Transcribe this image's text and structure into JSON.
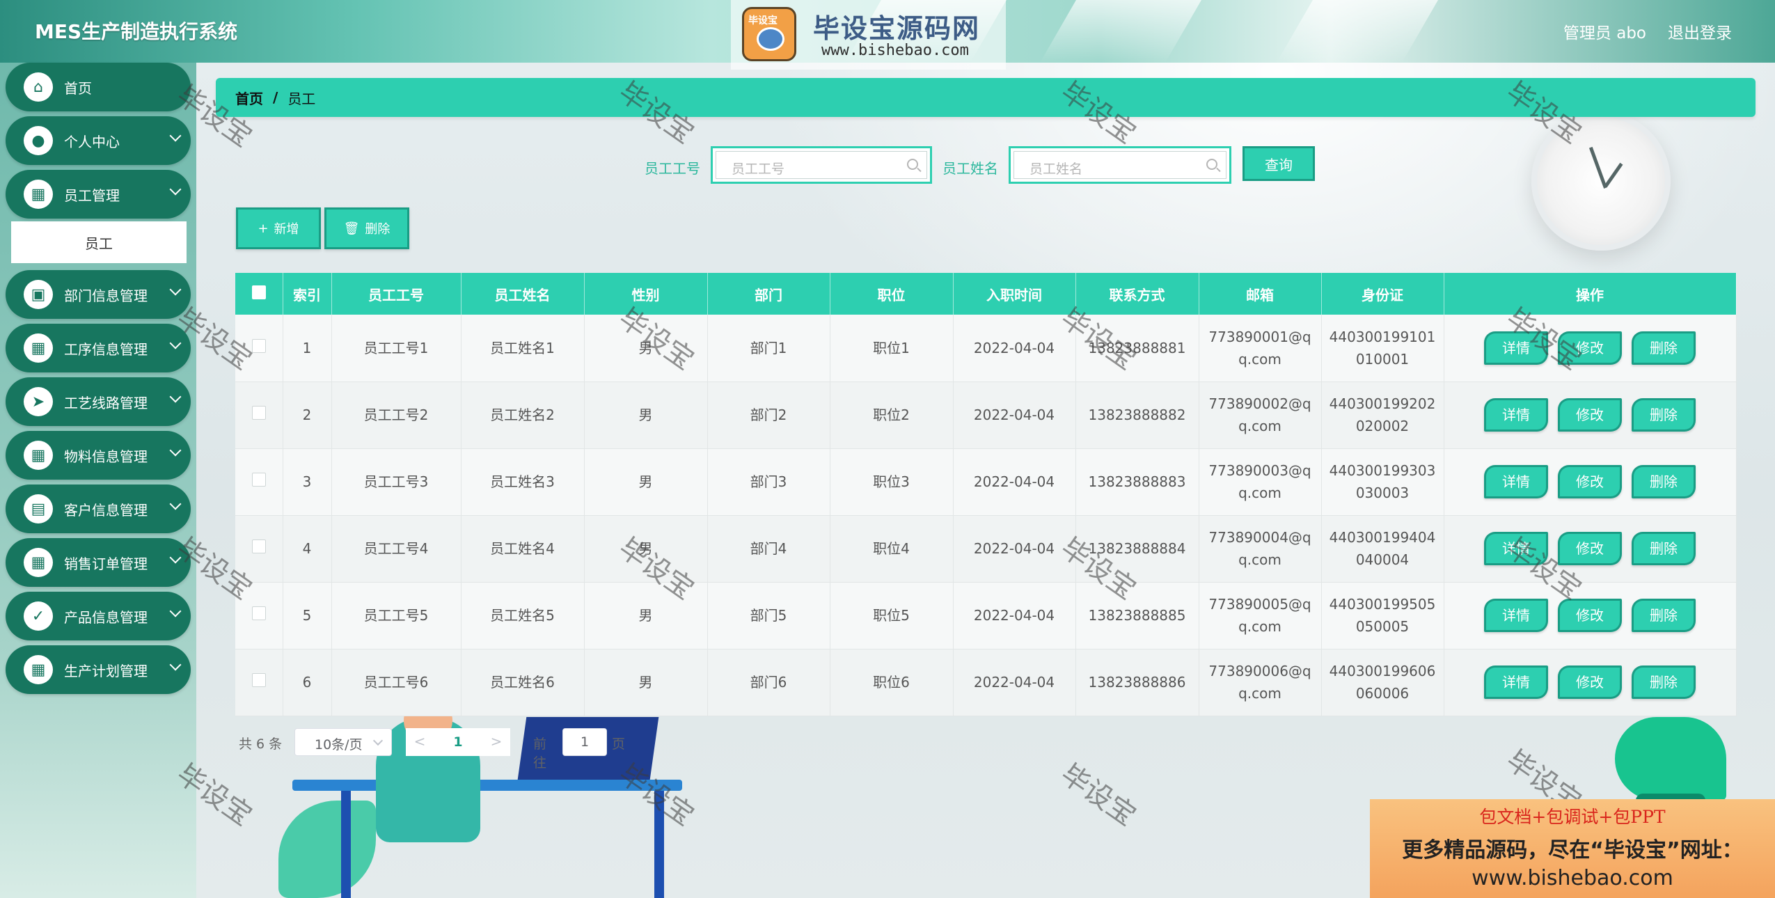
{
  "app": {
    "title": "MES生产制造执行系统",
    "user_label": "管理员 abo",
    "logout_label": "退出登录"
  },
  "watermark_logo": {
    "mascot_text": "毕设宝",
    "name": "毕设宝源码网",
    "url": "www.bishebao.com"
  },
  "sidebar": {
    "items": [
      {
        "label": "首页",
        "icon": "home-icon",
        "glyph": "⌂",
        "has_arrow": false
      },
      {
        "label": "个人中心",
        "icon": "user-icon",
        "glyph": "●",
        "has_arrow": true
      },
      {
        "label": "员工管理",
        "icon": "grid-icon",
        "glyph": "▦",
        "has_arrow": true
      },
      {
        "label": "部门信息管理",
        "icon": "briefcase-icon",
        "glyph": "▣",
        "has_arrow": true
      },
      {
        "label": "工序信息管理",
        "icon": "grid-icon",
        "glyph": "▦",
        "has_arrow": true
      },
      {
        "label": "工艺线路管理",
        "icon": "send-icon",
        "glyph": "➤",
        "has_arrow": true
      },
      {
        "label": "物料信息管理",
        "icon": "grid-icon",
        "glyph": "▦",
        "has_arrow": true
      },
      {
        "label": "客户信息管理",
        "icon": "chart-icon",
        "glyph": "▤",
        "has_arrow": true
      },
      {
        "label": "销售订单管理",
        "icon": "grid-icon",
        "glyph": "▦",
        "has_arrow": true
      },
      {
        "label": "产品信息管理",
        "icon": "clipboard-icon",
        "glyph": "✓",
        "has_arrow": true
      },
      {
        "label": "生产计划管理",
        "icon": "grid-icon",
        "glyph": "▦",
        "has_arrow": true
      }
    ],
    "submenu_label": "员工"
  },
  "breadcrumb": {
    "home": "首页",
    "separator": "/",
    "current": "员工"
  },
  "search": {
    "emp_no_label": "员工工号",
    "emp_no_placeholder": "员工工号",
    "emp_name_label": "员工姓名",
    "emp_name_placeholder": "员工姓名",
    "query_label": "查询"
  },
  "actions": {
    "add_label": "新增",
    "add_symbol": "+",
    "delete_label": "删除",
    "delete_symbol": "🗑"
  },
  "table": {
    "headers": [
      "索引",
      "员工工号",
      "员工姓名",
      "性别",
      "部门",
      "职位",
      "入职时间",
      "联系方式",
      "邮箱",
      "身份证",
      "操作"
    ],
    "row_actions": [
      "详情",
      "修改",
      "删除"
    ],
    "rows": [
      {
        "index": "1",
        "emp_no": "员工工号1",
        "name": "员工姓名1",
        "gender": "男",
        "dept": "部门1",
        "position": "职位1",
        "hire_date": "2022-04-04",
        "phone": "13823888881",
        "email_1": "773890001@q",
        "email_2": "q.com",
        "id_1": "440300199101",
        "id_2": "010001"
      },
      {
        "index": "2",
        "emp_no": "员工工号2",
        "name": "员工姓名2",
        "gender": "男",
        "dept": "部门2",
        "position": "职位2",
        "hire_date": "2022-04-04",
        "phone": "13823888882",
        "email_1": "773890002@q",
        "email_2": "q.com",
        "id_1": "440300199202",
        "id_2": "020002"
      },
      {
        "index": "3",
        "emp_no": "员工工号3",
        "name": "员工姓名3",
        "gender": "男",
        "dept": "部门3",
        "position": "职位3",
        "hire_date": "2022-04-04",
        "phone": "13823888883",
        "email_1": "773890003@q",
        "email_2": "q.com",
        "id_1": "440300199303",
        "id_2": "030003"
      },
      {
        "index": "4",
        "emp_no": "员工工号4",
        "name": "员工姓名4",
        "gender": "男",
        "dept": "部门4",
        "position": "职位4",
        "hire_date": "2022-04-04",
        "phone": "13823888884",
        "email_1": "773890004@q",
        "email_2": "q.com",
        "id_1": "440300199404",
        "id_2": "040004"
      },
      {
        "index": "5",
        "emp_no": "员工工号5",
        "name": "员工姓名5",
        "gender": "男",
        "dept": "部门5",
        "position": "职位5",
        "hire_date": "2022-04-04",
        "phone": "13823888885",
        "email_1": "773890005@q",
        "email_2": "q.com",
        "id_1": "440300199505",
        "id_2": "050005"
      },
      {
        "index": "6",
        "emp_no": "员工工号6",
        "name": "员工姓名6",
        "gender": "男",
        "dept": "部门6",
        "position": "职位6",
        "hire_date": "2022-04-04",
        "phone": "13823888886",
        "email_1": "773890006@q",
        "email_2": "q.com",
        "id_1": "440300199606",
        "id_2": "060006"
      }
    ]
  },
  "pagination": {
    "total": "共 6 条",
    "page_size": "10条/页",
    "prev": "<",
    "current_page": "1",
    "next": ">",
    "goto_label": "前往",
    "jump_value": "1",
    "page_suffix": "页"
  },
  "watermark_text": "毕设宝",
  "promo": {
    "line1": "包文档+包调试+包PPT",
    "line2": "更多精品源码，尽在“毕设宝”网址：",
    "line3": "www.bishebao.com"
  },
  "colors": {
    "accent": "#2dcfb0",
    "accent_dark": "#1a9d85",
    "sidebar_item": "#17765f"
  }
}
